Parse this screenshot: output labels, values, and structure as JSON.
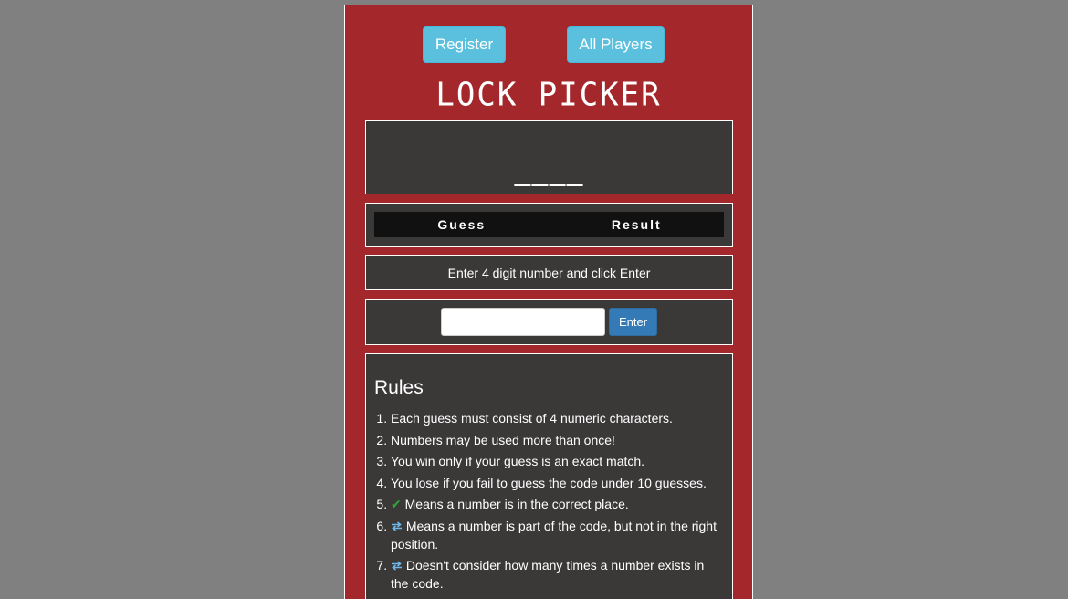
{
  "nav": {
    "register_label": "Register",
    "players_label": "All Players"
  },
  "title": "LOCK PICKER",
  "code_display": "____",
  "history": {
    "col_guess": "Guess",
    "col_result": "Result"
  },
  "message": "Enter 4 digit number and click Enter",
  "input": {
    "value": "",
    "placeholder": "",
    "enter_label": "Enter"
  },
  "rules": {
    "title": "Rules",
    "items": [
      "Each guess must consist of 4 numeric characters.",
      "Numbers may be used more than once!",
      "You win only if your guess is an exact match.",
      "You lose if you fail to guess the code under 10 guesses.",
      "Means a number is in the correct place.",
      "Means a number is part of the code, but not in the right position.",
      "Doesn't consider how many times a number exists in the code."
    ],
    "icons": [
      "check-icon",
      "swap-icon"
    ]
  },
  "colors": {
    "background": "#808080",
    "panel": "#a4282b",
    "box": "#3b3838",
    "info_button": "#5bc0de",
    "primary_button": "#337ab7",
    "check": "#2fa83a",
    "swap": "#6fb6e8"
  }
}
